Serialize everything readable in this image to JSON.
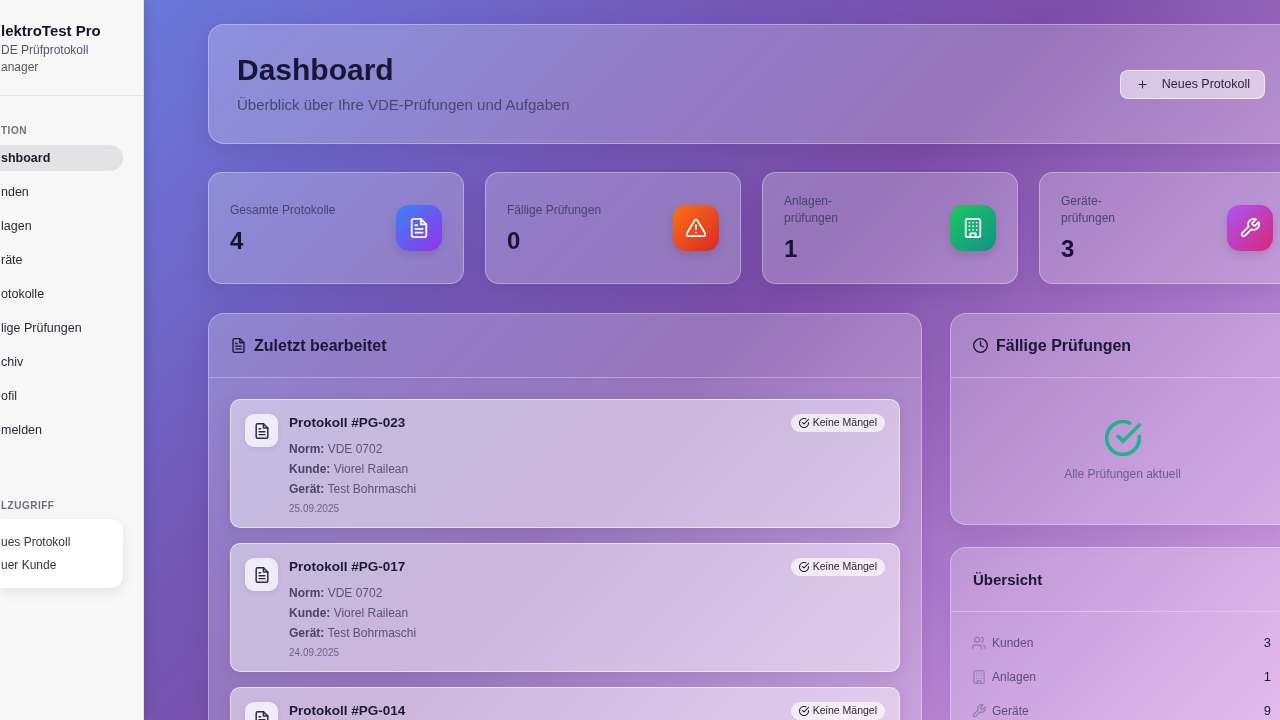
{
  "sidebar": {
    "brand": "lektroTest Pro",
    "subtitle_lines": [
      "DE Prüfprotokoll",
      "anager"
    ],
    "nav_heading": "TION",
    "nav_items": [
      {
        "label": "shboard",
        "selected": true
      },
      {
        "label": "nden",
        "selected": false
      },
      {
        "label": "lagen",
        "selected": false
      },
      {
        "label": "räte",
        "selected": false
      },
      {
        "label": "otokolle",
        "selected": false
      },
      {
        "label": "lige Prüfungen",
        "selected": false
      },
      {
        "label": "chiv",
        "selected": false
      },
      {
        "label": "ofil",
        "selected": false
      },
      {
        "label": "melden",
        "selected": false
      }
    ],
    "quick_heading": "LZUGRIFF",
    "quick_links": [
      "ues Protokoll",
      "uer Kunde"
    ]
  },
  "header": {
    "title": "Dashboard",
    "subtitle": "Überblick über Ihre VDE-Prüfungen und Aufgaben",
    "button": "Neues Protokoll"
  },
  "stats": [
    {
      "label": "Gesamte Protokolle",
      "value": "4"
    },
    {
      "label": "Fällige Prüfungen",
      "value": "0"
    },
    {
      "label": "Anlagen-\nprüfungen",
      "value": "1"
    },
    {
      "label": "Geräte-\nprüfungen",
      "value": "3"
    }
  ],
  "recent": {
    "title": "Zuletzt bearbeitet",
    "items": [
      {
        "title": "Protokoll #PG-023",
        "badge": "Keine Mängel",
        "fields": [
          "**Norm:** VDE 0702",
          "**Kunde:** Viorel Railean",
          "**Gerät:** Test Bohrmaschi"
        ],
        "date": "25.09.2025"
      },
      {
        "title": "Protokoll #PG-017",
        "badge": "Keine Mängel",
        "fields": [
          "**Norm:** VDE 0702",
          "**Kunde:** Viorel Railean",
          "**Gerät:** Test Bohrmaschi"
        ],
        "date": "24.09.2025"
      },
      {
        "title": "Protokoll #PG-014",
        "badge": "Keine Mängel"
      }
    ]
  },
  "due": {
    "title": "Fällige Prüfungen",
    "empty_message": "Alle Prüfungen aktuell"
  },
  "overview": {
    "title": "Übersicht",
    "rows": [
      {
        "label": "Kunden",
        "value": "3"
      },
      {
        "label": "Anlagen",
        "value": "1"
      },
      {
        "label": "Geräte",
        "value": "9"
      }
    ]
  }
}
